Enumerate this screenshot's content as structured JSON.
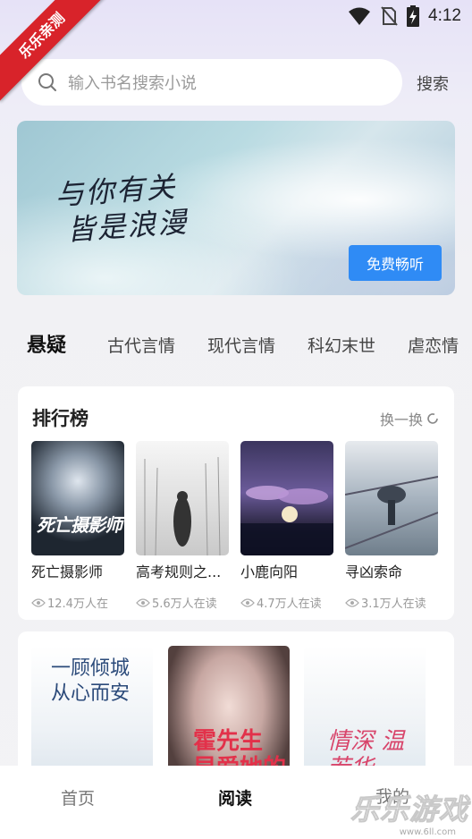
{
  "status_bar": {
    "time": "4:12"
  },
  "corner_ribbon": "乐乐亲测",
  "search": {
    "placeholder": "输入书名搜索小说",
    "button": "搜索"
  },
  "banner": {
    "line1": "与你有关",
    "line2": "皆是浪漫",
    "button": "免费畅听"
  },
  "tabs": [
    "悬疑",
    "古代言情",
    "现代言情",
    "科幻末世",
    "虐恋情"
  ],
  "ranking": {
    "title": "排行榜",
    "refresh_label": "换一换",
    "books": [
      {
        "title": "死亡摄影师",
        "readers": "12.4万人在",
        "cover_text": "死亡摄影师"
      },
      {
        "title": "高考规则之...",
        "readers": "5.6万人在读"
      },
      {
        "title": "小鹿向阳",
        "readers": "4.7万人在读"
      },
      {
        "title": "寻凶索命",
        "readers": "3.1万人在读"
      }
    ]
  },
  "featured": {
    "covers": [
      {
        "cover_text": "一顾倾城 从心而安"
      },
      {
        "cover_text": "霍先生 早爱她的"
      },
      {
        "cover_text": "情深 温若华"
      }
    ]
  },
  "bottom_nav": {
    "items": [
      "首页",
      "阅读",
      "我的"
    ],
    "active": "阅读"
  },
  "watermark": {
    "text": "乐乐游戏",
    "url": "www.6ll.com"
  }
}
